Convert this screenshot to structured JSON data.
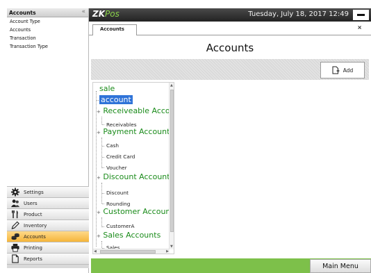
{
  "sidebar": {
    "header": "Accounts",
    "collapse_glyph": "«",
    "sub_items": [
      {
        "label": "Account Type"
      },
      {
        "label": "Accounts"
      },
      {
        "label": "Transaction"
      },
      {
        "label": "Transaction Type"
      }
    ],
    "nav": [
      {
        "label": "Settings",
        "icon": "gear-icon"
      },
      {
        "label": "Users",
        "icon": "users-icon"
      },
      {
        "label": "Product",
        "icon": "utensils-icon"
      },
      {
        "label": "Inventory",
        "icon": "pencil-icon"
      },
      {
        "label": "Accounts",
        "icon": "coins-icon",
        "active": true
      },
      {
        "label": "Printing",
        "icon": "printer-icon"
      },
      {
        "label": "Reports",
        "icon": "document-icon"
      }
    ]
  },
  "titlebar": {
    "logo_zk": "ZK",
    "logo_pos": "Pos",
    "datetime": "Tuesday, July 18, 2017 12:49"
  },
  "tab": {
    "label": "Accounts",
    "close": "×"
  },
  "page": {
    "title": "Accounts",
    "add_label": "Add"
  },
  "tree": {
    "root": "sale",
    "selected": "account",
    "groups": [
      {
        "label": "Receiveable Acco",
        "children": [
          "Receivables"
        ]
      },
      {
        "label": "Payment Accounts",
        "children": [
          "Cash",
          "Credit Card",
          "Voucher"
        ]
      },
      {
        "label": "Discount Accounts",
        "children": [
          "Discount",
          "Rounding"
        ]
      },
      {
        "label": "Customer Accoun",
        "children": [
          "CustomerA"
        ]
      },
      {
        "label": "Sales Accounts",
        "children": [
          "Sales"
        ]
      }
    ]
  },
  "statusbar": {
    "main_menu": "Main Menu"
  },
  "colors": {
    "accent_green": "#7dc04a",
    "tree_group_green": "#1a8b1a",
    "selection_blue": "#2f73d8",
    "active_nav_orange": "#f5b53a"
  }
}
